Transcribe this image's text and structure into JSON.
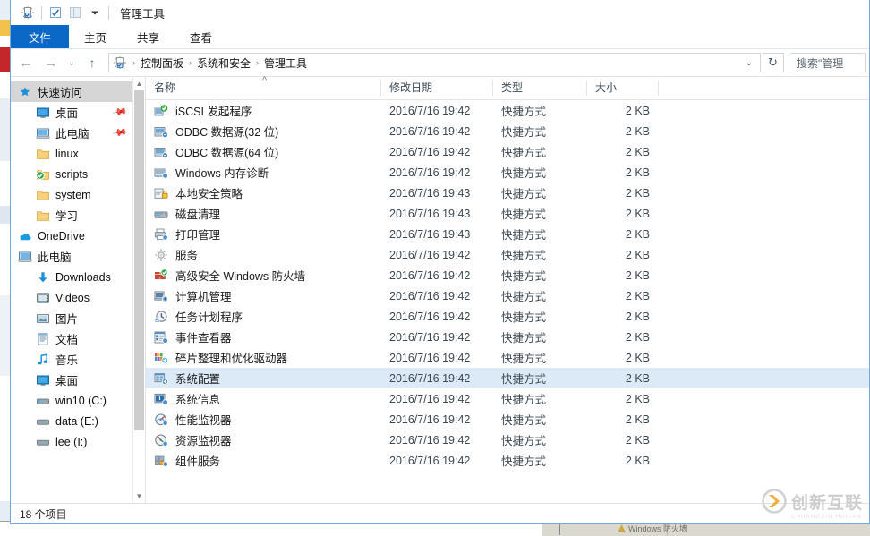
{
  "window": {
    "title": "管理工具",
    "quick_access_toolbar": [
      {
        "name": "properties-icon",
        "glyph": "properties"
      },
      {
        "name": "new-folder-icon",
        "glyph": "checkbox"
      },
      {
        "name": "view-icon",
        "glyph": "pane"
      },
      {
        "name": "customize-dropdown-icon",
        "glyph": "chevron-down"
      }
    ]
  },
  "ribbon": {
    "tabs": [
      {
        "label": "文件",
        "active": true
      },
      {
        "label": "主页",
        "active": false
      },
      {
        "label": "共享",
        "active": false
      },
      {
        "label": "查看",
        "active": false
      }
    ]
  },
  "address_bar": {
    "back_glyph": "←",
    "forward_glyph": "→",
    "history_glyph": "⌄",
    "up_glyph": "↑",
    "breadcrumb": [
      "控制面板",
      "系统和安全",
      "管理工具"
    ],
    "separator": "›",
    "dropdown_glyph": "⌄",
    "refresh_glyph": "↻",
    "search_placeholder": "搜索\"管理"
  },
  "nav_pane": {
    "groups": [
      {
        "root": {
          "label": "快速访问",
          "icon": "star-pin-icon",
          "selected": true
        },
        "items": [
          {
            "label": "桌面",
            "icon": "desktop-icon",
            "pinned": true
          },
          {
            "label": "此电脑",
            "icon": "computer-icon",
            "pinned": true
          },
          {
            "label": "linux",
            "icon": "folder-icon",
            "pinned": false
          },
          {
            "label": "scripts",
            "icon": "folder-sync-icon",
            "pinned": false
          },
          {
            "label": "system",
            "icon": "folder-icon",
            "pinned": false
          },
          {
            "label": "学习",
            "icon": "folder-icon",
            "pinned": false
          }
        ]
      },
      {
        "root": {
          "label": "OneDrive",
          "icon": "onedrive-icon",
          "selected": false
        },
        "items": []
      },
      {
        "root": {
          "label": "此电脑",
          "icon": "computer-icon",
          "selected": false
        },
        "items": [
          {
            "label": "Downloads",
            "icon": "downloads-icon",
            "pinned": false
          },
          {
            "label": "Videos",
            "icon": "videos-icon",
            "pinned": false
          },
          {
            "label": "图片",
            "icon": "pictures-icon",
            "pinned": false
          },
          {
            "label": "文档",
            "icon": "documents-icon",
            "pinned": false
          },
          {
            "label": "音乐",
            "icon": "music-icon",
            "pinned": false
          },
          {
            "label": "桌面",
            "icon": "desktop-icon",
            "pinned": false
          },
          {
            "label": "win10 (C:)",
            "icon": "os-drive-icon",
            "pinned": false
          },
          {
            "label": "data (E:)",
            "icon": "drive-icon",
            "pinned": false
          },
          {
            "label": "lee (I:)",
            "icon": "drive-icon",
            "pinned": false
          }
        ]
      }
    ]
  },
  "file_list": {
    "columns": [
      {
        "label": "名称",
        "key": "name",
        "sorted": "asc"
      },
      {
        "label": "修改日期",
        "key": "date"
      },
      {
        "label": "类型",
        "key": "type"
      },
      {
        "label": "大小",
        "key": "size"
      }
    ],
    "rows": [
      {
        "name": "iSCSI 发起程序",
        "date": "2016/7/16 19:42",
        "type": "快捷方式",
        "size": "2 KB",
        "icon": "iscsi-icon",
        "selected": false
      },
      {
        "name": "ODBC 数据源(32 位)",
        "date": "2016/7/16 19:42",
        "type": "快捷方式",
        "size": "2 KB",
        "icon": "odbc-icon",
        "selected": false
      },
      {
        "name": "ODBC 数据源(64 位)",
        "date": "2016/7/16 19:42",
        "type": "快捷方式",
        "size": "2 KB",
        "icon": "odbc-icon",
        "selected": false
      },
      {
        "name": "Windows 内存诊断",
        "date": "2016/7/16 19:42",
        "type": "快捷方式",
        "size": "2 KB",
        "icon": "memory-icon",
        "selected": false
      },
      {
        "name": "本地安全策略",
        "date": "2016/7/16 19:43",
        "type": "快捷方式",
        "size": "2 KB",
        "icon": "security-policy-icon",
        "selected": false
      },
      {
        "name": "磁盘清理",
        "date": "2016/7/16 19:43",
        "type": "快捷方式",
        "size": "2 KB",
        "icon": "disk-cleanup-icon",
        "selected": false
      },
      {
        "name": "打印管理",
        "date": "2016/7/16 19:43",
        "type": "快捷方式",
        "size": "2 KB",
        "icon": "print-management-icon",
        "selected": false
      },
      {
        "name": "服务",
        "date": "2016/7/16 19:42",
        "type": "快捷方式",
        "size": "2 KB",
        "icon": "services-icon",
        "selected": false
      },
      {
        "name": "高级安全 Windows 防火墙",
        "date": "2016/7/16 19:42",
        "type": "快捷方式",
        "size": "2 KB",
        "icon": "firewall-icon",
        "selected": false
      },
      {
        "name": "计算机管理",
        "date": "2016/7/16 19:42",
        "type": "快捷方式",
        "size": "2 KB",
        "icon": "computer-management-icon",
        "selected": false
      },
      {
        "name": "任务计划程序",
        "date": "2016/7/16 19:42",
        "type": "快捷方式",
        "size": "2 KB",
        "icon": "task-scheduler-icon",
        "selected": false
      },
      {
        "name": "事件查看器",
        "date": "2016/7/16 19:42",
        "type": "快捷方式",
        "size": "2 KB",
        "icon": "event-viewer-icon",
        "selected": false
      },
      {
        "name": "碎片整理和优化驱动器",
        "date": "2016/7/16 19:42",
        "type": "快捷方式",
        "size": "2 KB",
        "icon": "defrag-icon",
        "selected": false
      },
      {
        "name": "系统配置",
        "date": "2016/7/16 19:42",
        "type": "快捷方式",
        "size": "2 KB",
        "icon": "msconfig-icon",
        "selected": true
      },
      {
        "name": "系统信息",
        "date": "2016/7/16 19:42",
        "type": "快捷方式",
        "size": "2 KB",
        "icon": "system-info-icon",
        "selected": false
      },
      {
        "name": "性能监视器",
        "date": "2016/7/16 19:42",
        "type": "快捷方式",
        "size": "2 KB",
        "icon": "perfmon-icon",
        "selected": false
      },
      {
        "name": "资源监视器",
        "date": "2016/7/16 19:42",
        "type": "快捷方式",
        "size": "2 KB",
        "icon": "resmon-icon",
        "selected": false
      },
      {
        "name": "组件服务",
        "date": "2016/7/16 19:42",
        "type": "快捷方式",
        "size": "2 KB",
        "icon": "component-services-icon",
        "selected": false
      }
    ]
  },
  "status_bar": {
    "item_count": "18 个项目"
  },
  "background_window": {
    "taskbar_item": "Windows 防火墙"
  },
  "watermark": {
    "text": "创新互联",
    "subtext": "CHUANGXIN HULIAN"
  },
  "colors": {
    "accent": "#0c68c7",
    "selection": "#dceaf7",
    "nav_selection": "#d6d6d6",
    "window_border": "#6fa8dc",
    "header_text": "#3d4b57"
  }
}
